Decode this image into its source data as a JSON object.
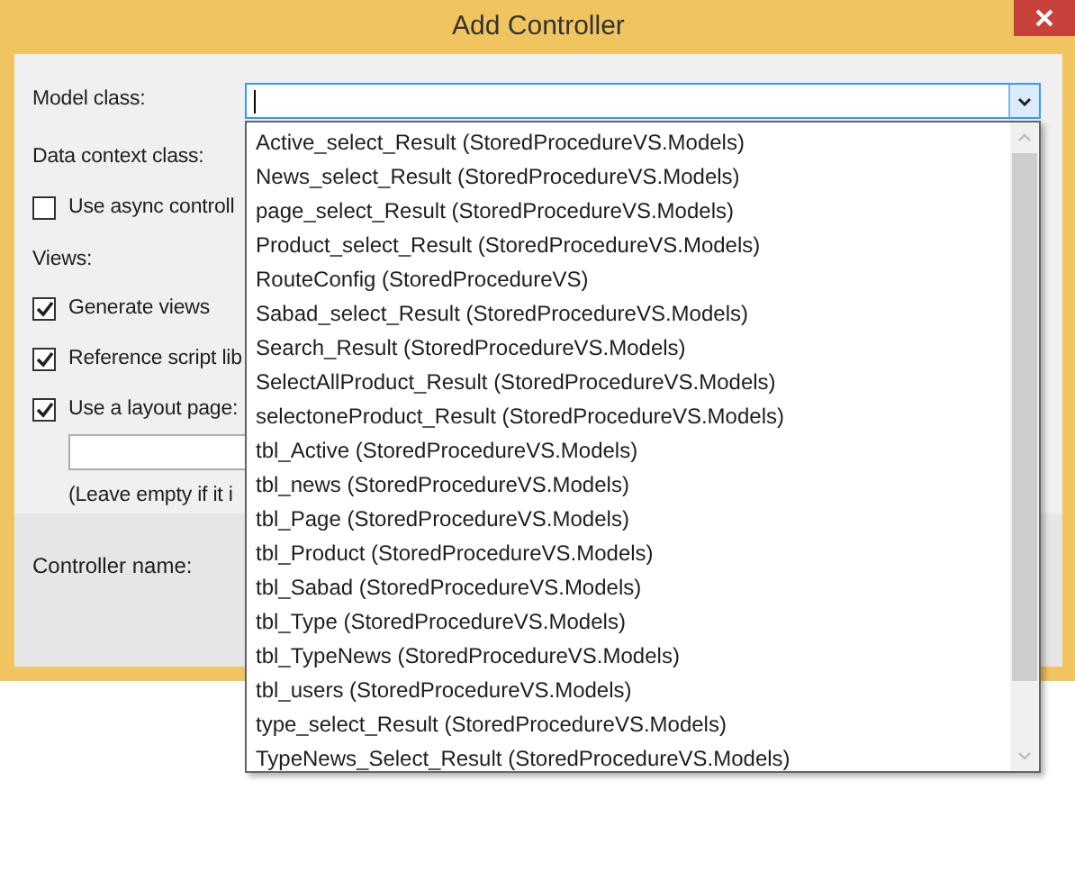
{
  "window": {
    "title": "Add Controller"
  },
  "form": {
    "model_class_label": "Model class:",
    "data_context_label": "Data context class:",
    "async_option": {
      "label": "Use async controll",
      "checked": false
    },
    "views_label": "Views:",
    "view_options": [
      {
        "label": "Generate views",
        "checked": true
      },
      {
        "label": "Reference script lib",
        "checked": true
      },
      {
        "label": "Use a layout page:",
        "checked": true
      }
    ],
    "layout_hint": "(Leave empty if it i",
    "controller_name_label": "Controller name:"
  },
  "model_dropdown": {
    "items": [
      "Active_select_Result (StoredProcedureVS.Models)",
      "News_select_Result (StoredProcedureVS.Models)",
      "page_select_Result (StoredProcedureVS.Models)",
      "Product_select_Result (StoredProcedureVS.Models)",
      "RouteConfig (StoredProcedureVS)",
      "Sabad_select_Result (StoredProcedureVS.Models)",
      "Search_Result (StoredProcedureVS.Models)",
      "SelectAllProduct_Result (StoredProcedureVS.Models)",
      "selectoneProduct_Result (StoredProcedureVS.Models)",
      "tbl_Active (StoredProcedureVS.Models)",
      "tbl_news (StoredProcedureVS.Models)",
      "tbl_Page (StoredProcedureVS.Models)",
      "tbl_Product (StoredProcedureVS.Models)",
      "tbl_Sabad (StoredProcedureVS.Models)",
      "tbl_Type (StoredProcedureVS.Models)",
      "tbl_TypeNews (StoredProcedureVS.Models)",
      "tbl_users (StoredProcedureVS.Models)",
      "type_select_Result (StoredProcedureVS.Models)",
      "TypeNews_Select_Result (StoredProcedureVS.Models)"
    ]
  }
}
